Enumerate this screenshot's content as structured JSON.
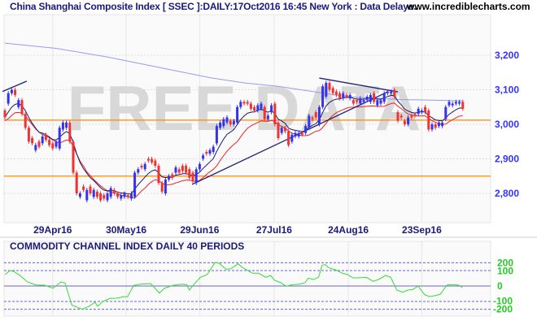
{
  "header": {
    "title": "China Shanghai Composite Index [ SSEC ]:DAILY:17Oct2016 16:45 New York : Data Delaye..",
    "site": "www.incrediblecharts.com"
  },
  "watermark": "FREE DATA",
  "colors": {
    "up": "#3333ee",
    "down": "#ee3333",
    "ma_short": "#1a1a6e",
    "ma_red": "#ee2222",
    "ma_long": "#9999ee",
    "hline": "#ff8800",
    "trend": "#22227a",
    "cci": "#33dd33",
    "axis_price": "#3333ff",
    "axis_cci": "#22cc22",
    "date": "#1a1a7a"
  },
  "chart_data": [
    {
      "type": "candlestick",
      "title": "China Shanghai Composite Index [ SSEC ] DAILY",
      "ylim": [
        2730,
        3275
      ],
      "y_ticks": [
        {
          "v": 3200,
          "label": "3,200"
        },
        {
          "v": 3100,
          "label": "3,100"
        },
        {
          "v": 3000,
          "label": "3,000"
        },
        {
          "v": 2900,
          "label": "2,900"
        },
        {
          "v": 2800,
          "label": "2,800"
        }
      ],
      "x_ticks": [
        {
          "i": 14,
          "label": "29Apr16"
        },
        {
          "i": 35.5,
          "label": "30May16"
        },
        {
          "i": 57,
          "label": "29Jun16"
        },
        {
          "i": 78.8,
          "label": "27Jul16"
        },
        {
          "i": 100.5,
          "label": "24Aug16"
        },
        {
          "i": 122,
          "label": "23Sep16"
        }
      ],
      "candles_open_close": [
        [
          3040,
          3020
        ],
        [
          3060,
          3090
        ],
        [
          3090,
          3100
        ],
        [
          3100,
          3085
        ],
        [
          3050,
          3070
        ],
        [
          3070,
          3030
        ],
        [
          3030,
          2990
        ],
        [
          2990,
          2950
        ],
        [
          2960,
          2945
        ],
        [
          2925,
          2940
        ],
        [
          2950,
          2935
        ],
        [
          2945,
          2965
        ],
        [
          2970,
          2955
        ],
        [
          2955,
          2940
        ],
        [
          2945,
          2930
        ],
        [
          2935,
          2950
        ],
        [
          2930,
          2990
        ],
        [
          2985,
          3005
        ],
        [
          2990,
          3005
        ],
        [
          3005,
          2950
        ],
        [
          2950,
          2860
        ],
        [
          2860,
          2800
        ],
        [
          2790,
          2800
        ],
        [
          2820,
          2810
        ],
        [
          2780,
          2810
        ],
        [
          2820,
          2800
        ],
        [
          2790,
          2810
        ],
        [
          2805,
          2790
        ],
        [
          2800,
          2780
        ],
        [
          2795,
          2785
        ],
        [
          2780,
          2800
        ],
        [
          2790,
          2815
        ],
        [
          2810,
          2800
        ],
        [
          2800,
          2790
        ],
        [
          2785,
          2795
        ],
        [
          2790,
          2800
        ],
        [
          2795,
          2790
        ],
        [
          2785,
          2800
        ],
        [
          2790,
          2860
        ],
        [
          2860,
          2870
        ],
        [
          2880,
          2875
        ],
        [
          2870,
          2885
        ],
        [
          2900,
          2895
        ],
        [
          2900,
          2890
        ],
        [
          2895,
          2880
        ],
        [
          2880,
          2830
        ],
        [
          2830,
          2805
        ],
        [
          2800,
          2840
        ],
        [
          2840,
          2850
        ],
        [
          2855,
          2845
        ],
        [
          2860,
          2875
        ],
        [
          2870,
          2860
        ],
        [
          2880,
          2865
        ],
        [
          2880,
          2860
        ],
        [
          2870,
          2845
        ],
        [
          2860,
          2835
        ],
        [
          2830,
          2870
        ],
        [
          2870,
          2885
        ],
        [
          2900,
          2910
        ],
        [
          2920,
          2915
        ],
        [
          2915,
          2925
        ],
        [
          2920,
          2935
        ],
        [
          2945,
          2995
        ],
        [
          2990,
          3005
        ],
        [
          2995,
          3015
        ],
        [
          3005,
          3020
        ],
        [
          3010,
          3000
        ],
        [
          3000,
          3010
        ],
        [
          3005,
          3050
        ],
        [
          3050,
          3065
        ],
        [
          3065,
          3060
        ],
        [
          3065,
          3060
        ],
        [
          3060,
          3045
        ],
        [
          3050,
          3040
        ],
        [
          3040,
          3055
        ],
        [
          3045,
          3060
        ],
        [
          3050,
          3015
        ],
        [
          3015,
          3025
        ],
        [
          3035,
          3055
        ],
        [
          3060,
          3000
        ],
        [
          3005,
          2960
        ],
        [
          2975,
          2990
        ],
        [
          2990,
          2980
        ],
        [
          2980,
          2940
        ],
        [
          2950,
          2970
        ],
        [
          2965,
          2975
        ],
        [
          2965,
          2975
        ],
        [
          2975,
          2970
        ],
        [
          2975,
          2995
        ],
        [
          2990,
          3025
        ],
        [
          3020,
          3015
        ],
        [
          3035,
          3020
        ],
        [
          3000,
          3050
        ],
        [
          3050,
          3110
        ],
        [
          3080,
          3120
        ],
        [
          3120,
          3100
        ],
        [
          3105,
          3090
        ],
        [
          3095,
          3085
        ],
        [
          3090,
          3075
        ],
        [
          3075,
          3090
        ],
        [
          3085,
          3080
        ],
        [
          3075,
          3085
        ],
        [
          3070,
          3060
        ],
        [
          3070,
          3065
        ],
        [
          3060,
          3075
        ],
        [
          3065,
          3070
        ],
        [
          3070,
          3080
        ],
        [
          3065,
          3085
        ],
        [
          3090,
          3065
        ],
        [
          3055,
          3070
        ],
        [
          3060,
          3070
        ],
        [
          3065,
          3090
        ],
        [
          3090,
          3095
        ],
        [
          3090,
          3095
        ],
        [
          3100,
          3080
        ],
        [
          3035,
          3010
        ],
        [
          3025,
          3020
        ],
        [
          3010,
          3000
        ],
        [
          3000,
          3020
        ],
        [
          3025,
          3020
        ],
        [
          3030,
          3025
        ],
        [
          3030,
          3045
        ],
        [
          3035,
          3040
        ],
        [
          3050,
          3035
        ],
        [
          3040,
          2985
        ],
        [
          2985,
          3000
        ],
        [
          3000,
          2990
        ],
        [
          2995,
          3005
        ],
        [
          2995,
          3005
        ],
        [
          3015,
          3050
        ],
        [
          3055,
          3065
        ],
        [
          3055,
          3060
        ],
        [
          3060,
          3065
        ],
        [
          3060,
          3065
        ],
        [
          3065,
          3045
        ]
      ],
      "ma_long": [
        [
          0,
          3235
        ],
        [
          15,
          3220
        ],
        [
          30,
          3195
        ],
        [
          45,
          3165
        ],
        [
          60,
          3135
        ],
        [
          70,
          3120
        ],
        [
          80,
          3110
        ],
        [
          90,
          3095
        ],
        [
          100,
          3080
        ],
        [
          115,
          3072
        ],
        [
          134,
          3068
        ]
      ],
      "horizontal_lines": [
        3012,
        2850
      ],
      "trendlines": [
        [
          [
            -0.7,
            3095
          ],
          [
            6.4,
            3125
          ]
        ],
        [
          [
            54.8,
            2826
          ],
          [
            112,
            3094
          ]
        ],
        [
          [
            92,
            3134
          ],
          [
            115,
            3094
          ]
        ]
      ]
    },
    {
      "type": "line",
      "title": "COMMODITY CHANNEL INDEX DAILY 40 PERIODS",
      "ylim": [
        -260,
        260
      ],
      "y_ticks": [
        {
          "v": 200,
          "label": "200"
        },
        {
          "v": 100,
          "label": "100"
        },
        {
          "v": 0,
          "label": "0"
        },
        {
          "v": -100,
          "label": "-100"
        },
        {
          "v": -200,
          "label": "-200"
        }
      ],
      "dashed_levels": [
        200,
        133,
        -133,
        -200
      ],
      "cci": [
        [
          0.1,
          98
        ],
        [
          1.4,
          133
        ],
        [
          2.6,
          126
        ],
        [
          4.6,
          86
        ],
        [
          6.6,
          35
        ],
        [
          9.1,
          9
        ],
        [
          11.6,
          7
        ],
        [
          14.1,
          -19
        ],
        [
          16.4,
          35
        ],
        [
          17.6,
          26
        ],
        [
          19.6,
          -165
        ],
        [
          21.1,
          -182
        ],
        [
          22.6,
          -200
        ],
        [
          24.6,
          -175
        ],
        [
          26.4,
          -140
        ],
        [
          27.1,
          -175
        ],
        [
          28.6,
          -135
        ],
        [
          30.7,
          -107
        ],
        [
          32.7,
          -105
        ],
        [
          34.7,
          -93
        ],
        [
          35.9,
          -93
        ],
        [
          37.7,
          5
        ],
        [
          39.7,
          16
        ],
        [
          42.7,
          21
        ],
        [
          45.2,
          -61
        ],
        [
          46.7,
          -19
        ],
        [
          49.2,
          5
        ],
        [
          51.7,
          16
        ],
        [
          53.2,
          12
        ],
        [
          54,
          -35
        ],
        [
          55.2,
          9
        ],
        [
          57.2,
          75
        ],
        [
          59.2,
          98
        ],
        [
          61.5,
          203
        ],
        [
          62.7,
          196
        ],
        [
          64.7,
          144
        ],
        [
          66.2,
          149
        ],
        [
          68.2,
          191
        ],
        [
          69.7,
          156
        ],
        [
          72.5,
          110
        ],
        [
          74.3,
          110
        ],
        [
          76.3,
          75
        ],
        [
          77.8,
          91
        ],
        [
          78.8,
          51
        ],
        [
          80.8,
          28
        ],
        [
          82.3,
          -2
        ],
        [
          84.3,
          12
        ],
        [
          86.3,
          16
        ],
        [
          87.8,
          28
        ],
        [
          88.8,
          68
        ],
        [
          90.3,
          56
        ],
        [
          91.8,
          75
        ],
        [
          92.8,
          179
        ],
        [
          93.8,
          184
        ],
        [
          94.8,
          156
        ],
        [
          96.8,
          138
        ],
        [
          98.8,
          110
        ],
        [
          100.3,
          98
        ],
        [
          101.8,
          70
        ],
        [
          103.3,
          70
        ],
        [
          105.8,
          75
        ],
        [
          107.8,
          40
        ],
        [
          109.8,
          63
        ],
        [
          111.4,
          91
        ],
        [
          112.9,
          75
        ],
        [
          114.7,
          -35
        ],
        [
          116.4,
          -54
        ],
        [
          117.9,
          -35
        ],
        [
          119.4,
          -30
        ],
        [
          120.9,
          0
        ],
        [
          122.9,
          -77
        ],
        [
          124.4,
          -91
        ],
        [
          125.9,
          -82
        ],
        [
          127.4,
          -72
        ],
        [
          129.4,
          9
        ],
        [
          131.4,
          12
        ],
        [
          132.9,
          5
        ],
        [
          133.9,
          -14
        ]
      ]
    }
  ]
}
